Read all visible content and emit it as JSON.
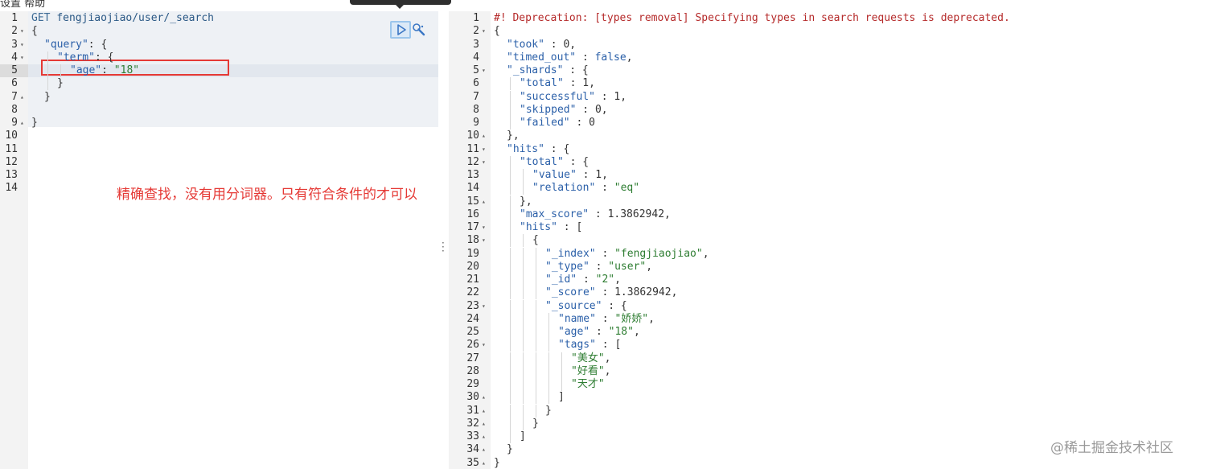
{
  "top_menu": {
    "text": "设置    帮助"
  },
  "request": {
    "lines": [
      {
        "n": "1",
        "fold": "",
        "indent": 0,
        "parts": [
          [
            "k-method",
            "GET "
          ],
          [
            "k-url",
            "fengjiaojiao/user/_search"
          ]
        ]
      },
      {
        "n": "2",
        "fold": "▾",
        "indent": 0,
        "parts": [
          [
            "k-punc",
            "{"
          ]
        ]
      },
      {
        "n": "3",
        "fold": "▾",
        "indent": 1,
        "parts": [
          [
            "k-key",
            "\"query\""
          ],
          [
            "k-punc",
            ": {"
          ]
        ]
      },
      {
        "n": "4",
        "fold": "▾",
        "indent": 2,
        "parts": [
          [
            "k-key",
            "\"term\""
          ],
          [
            "k-punc",
            ": {"
          ]
        ]
      },
      {
        "n": "5",
        "fold": "",
        "indent": 3,
        "parts": [
          [
            "k-key",
            "\"age\""
          ],
          [
            "k-punc",
            ": "
          ],
          [
            "k-str",
            "\"18\""
          ]
        ]
      },
      {
        "n": "6",
        "fold": "",
        "indent": 2,
        "parts": [
          [
            "k-punc",
            "}"
          ]
        ]
      },
      {
        "n": "7",
        "fold": "▴",
        "indent": 1,
        "parts": [
          [
            "k-punc",
            "}"
          ]
        ]
      },
      {
        "n": "8",
        "fold": "",
        "indent": 0,
        "parts": []
      },
      {
        "n": "9",
        "fold": "▴",
        "indent": 0,
        "parts": [
          [
            "k-punc",
            "}"
          ]
        ]
      },
      {
        "n": "10",
        "fold": "",
        "indent": 0,
        "parts": []
      },
      {
        "n": "11",
        "fold": "",
        "indent": 0,
        "parts": []
      },
      {
        "n": "12",
        "fold": "",
        "indent": 0,
        "parts": []
      },
      {
        "n": "13",
        "fold": "",
        "indent": 0,
        "parts": []
      },
      {
        "n": "14",
        "fold": "",
        "indent": 0,
        "parts": []
      }
    ]
  },
  "annotation": "精确查找，没有用分词器。只有符合条件的才可以",
  "response": {
    "lines": [
      {
        "n": "1",
        "fold": "",
        "indent": 0,
        "parts": [
          [
            "k-warn",
            "#! Deprecation: [types removal] Specifying types in search requests is deprecated."
          ]
        ]
      },
      {
        "n": "2",
        "fold": "▾",
        "indent": 0,
        "parts": [
          [
            "k-punc",
            "{"
          ]
        ]
      },
      {
        "n": "3",
        "fold": "",
        "indent": 1,
        "parts": [
          [
            "k-key",
            "\"took\""
          ],
          [
            "k-punc",
            " : "
          ],
          [
            "k-num",
            "0"
          ],
          [
            "k-punc",
            ","
          ]
        ]
      },
      {
        "n": "4",
        "fold": "",
        "indent": 1,
        "parts": [
          [
            "k-key",
            "\"timed_out\""
          ],
          [
            "k-punc",
            " : "
          ],
          [
            "k-bool",
            "false"
          ],
          [
            "k-punc",
            ","
          ]
        ]
      },
      {
        "n": "5",
        "fold": "▾",
        "indent": 1,
        "parts": [
          [
            "k-key",
            "\"_shards\""
          ],
          [
            "k-punc",
            " : {"
          ]
        ]
      },
      {
        "n": "6",
        "fold": "",
        "indent": 2,
        "parts": [
          [
            "k-key",
            "\"total\""
          ],
          [
            "k-punc",
            " : "
          ],
          [
            "k-num",
            "1"
          ],
          [
            "k-punc",
            ","
          ]
        ]
      },
      {
        "n": "7",
        "fold": "",
        "indent": 2,
        "parts": [
          [
            "k-key",
            "\"successful\""
          ],
          [
            "k-punc",
            " : "
          ],
          [
            "k-num",
            "1"
          ],
          [
            "k-punc",
            ","
          ]
        ]
      },
      {
        "n": "8",
        "fold": "",
        "indent": 2,
        "parts": [
          [
            "k-key",
            "\"skipped\""
          ],
          [
            "k-punc",
            " : "
          ],
          [
            "k-num",
            "0"
          ],
          [
            "k-punc",
            ","
          ]
        ]
      },
      {
        "n": "9",
        "fold": "",
        "indent": 2,
        "parts": [
          [
            "k-key",
            "\"failed\""
          ],
          [
            "k-punc",
            " : "
          ],
          [
            "k-num",
            "0"
          ]
        ]
      },
      {
        "n": "10",
        "fold": "▴",
        "indent": 1,
        "parts": [
          [
            "k-punc",
            "},"
          ]
        ]
      },
      {
        "n": "11",
        "fold": "▾",
        "indent": 1,
        "parts": [
          [
            "k-key",
            "\"hits\""
          ],
          [
            "k-punc",
            " : {"
          ]
        ]
      },
      {
        "n": "12",
        "fold": "▾",
        "indent": 2,
        "parts": [
          [
            "k-key",
            "\"total\""
          ],
          [
            "k-punc",
            " : {"
          ]
        ]
      },
      {
        "n": "13",
        "fold": "",
        "indent": 3,
        "parts": [
          [
            "k-key",
            "\"value\""
          ],
          [
            "k-punc",
            " : "
          ],
          [
            "k-num",
            "1"
          ],
          [
            "k-punc",
            ","
          ]
        ]
      },
      {
        "n": "14",
        "fold": "",
        "indent": 3,
        "parts": [
          [
            "k-key",
            "\"relation\""
          ],
          [
            "k-punc",
            " : "
          ],
          [
            "k-str",
            "\"eq\""
          ]
        ]
      },
      {
        "n": "15",
        "fold": "▴",
        "indent": 2,
        "parts": [
          [
            "k-punc",
            "},"
          ]
        ]
      },
      {
        "n": "16",
        "fold": "",
        "indent": 2,
        "parts": [
          [
            "k-key",
            "\"max_score\""
          ],
          [
            "k-punc",
            " : "
          ],
          [
            "k-num",
            "1.3862942"
          ],
          [
            "k-punc",
            ","
          ]
        ]
      },
      {
        "n": "17",
        "fold": "▾",
        "indent": 2,
        "parts": [
          [
            "k-key",
            "\"hits\""
          ],
          [
            "k-punc",
            " : ["
          ]
        ]
      },
      {
        "n": "18",
        "fold": "▾",
        "indent": 3,
        "parts": [
          [
            "k-punc",
            "{"
          ]
        ]
      },
      {
        "n": "19",
        "fold": "",
        "indent": 4,
        "parts": [
          [
            "k-key",
            "\"_index\""
          ],
          [
            "k-punc",
            " : "
          ],
          [
            "k-str",
            "\"fengjiaojiao\""
          ],
          [
            "k-punc",
            ","
          ]
        ]
      },
      {
        "n": "20",
        "fold": "",
        "indent": 4,
        "parts": [
          [
            "k-key",
            "\"_type\""
          ],
          [
            "k-punc",
            " : "
          ],
          [
            "k-str",
            "\"user\""
          ],
          [
            "k-punc",
            ","
          ]
        ]
      },
      {
        "n": "21",
        "fold": "",
        "indent": 4,
        "parts": [
          [
            "k-key",
            "\"_id\""
          ],
          [
            "k-punc",
            " : "
          ],
          [
            "k-str",
            "\"2\""
          ],
          [
            "k-punc",
            ","
          ]
        ]
      },
      {
        "n": "22",
        "fold": "",
        "indent": 4,
        "parts": [
          [
            "k-key",
            "\"_score\""
          ],
          [
            "k-punc",
            " : "
          ],
          [
            "k-num",
            "1.3862942"
          ],
          [
            "k-punc",
            ","
          ]
        ]
      },
      {
        "n": "23",
        "fold": "▾",
        "indent": 4,
        "parts": [
          [
            "k-key",
            "\"_source\""
          ],
          [
            "k-punc",
            " : {"
          ]
        ]
      },
      {
        "n": "24",
        "fold": "",
        "indent": 5,
        "parts": [
          [
            "k-key",
            "\"name\""
          ],
          [
            "k-punc",
            " : "
          ],
          [
            "k-str",
            "\"娇娇\""
          ],
          [
            "k-punc",
            ","
          ]
        ]
      },
      {
        "n": "25",
        "fold": "",
        "indent": 5,
        "parts": [
          [
            "k-key",
            "\"age\""
          ],
          [
            "k-punc",
            " : "
          ],
          [
            "k-str",
            "\"18\""
          ],
          [
            "k-punc",
            ","
          ]
        ]
      },
      {
        "n": "26",
        "fold": "▾",
        "indent": 5,
        "parts": [
          [
            "k-key",
            "\"tags\""
          ],
          [
            "k-punc",
            " : ["
          ]
        ]
      },
      {
        "n": "27",
        "fold": "",
        "indent": 6,
        "parts": [
          [
            "k-str",
            "\"美女\""
          ],
          [
            "k-punc",
            ","
          ]
        ]
      },
      {
        "n": "28",
        "fold": "",
        "indent": 6,
        "parts": [
          [
            "k-str",
            "\"好看\""
          ],
          [
            "k-punc",
            ","
          ]
        ]
      },
      {
        "n": "29",
        "fold": "",
        "indent": 6,
        "parts": [
          [
            "k-str",
            "\"天才\""
          ]
        ]
      },
      {
        "n": "30",
        "fold": "▴",
        "indent": 5,
        "parts": [
          [
            "k-punc",
            "]"
          ]
        ]
      },
      {
        "n": "31",
        "fold": "▴",
        "indent": 4,
        "parts": [
          [
            "k-punc",
            "}"
          ]
        ]
      },
      {
        "n": "32",
        "fold": "▴",
        "indent": 3,
        "parts": [
          [
            "k-punc",
            "}"
          ]
        ]
      },
      {
        "n": "33",
        "fold": "▴",
        "indent": 2,
        "parts": [
          [
            "k-punc",
            "]"
          ]
        ]
      },
      {
        "n": "34",
        "fold": "▴",
        "indent": 1,
        "parts": [
          [
            "k-punc",
            "}"
          ]
        ]
      },
      {
        "n": "35",
        "fold": "▴",
        "indent": 0,
        "parts": [
          [
            "k-punc",
            "}"
          ]
        ]
      }
    ]
  },
  "icons": {
    "run": "play-icon",
    "settings": "wrench-icon",
    "resizer": "vertical-dots-icon"
  },
  "watermark": "@稀土掘金技术社区",
  "colors": {
    "highlight_box": "#e53935",
    "annotation": "#e53935",
    "run_button": "#9cc6ec"
  }
}
